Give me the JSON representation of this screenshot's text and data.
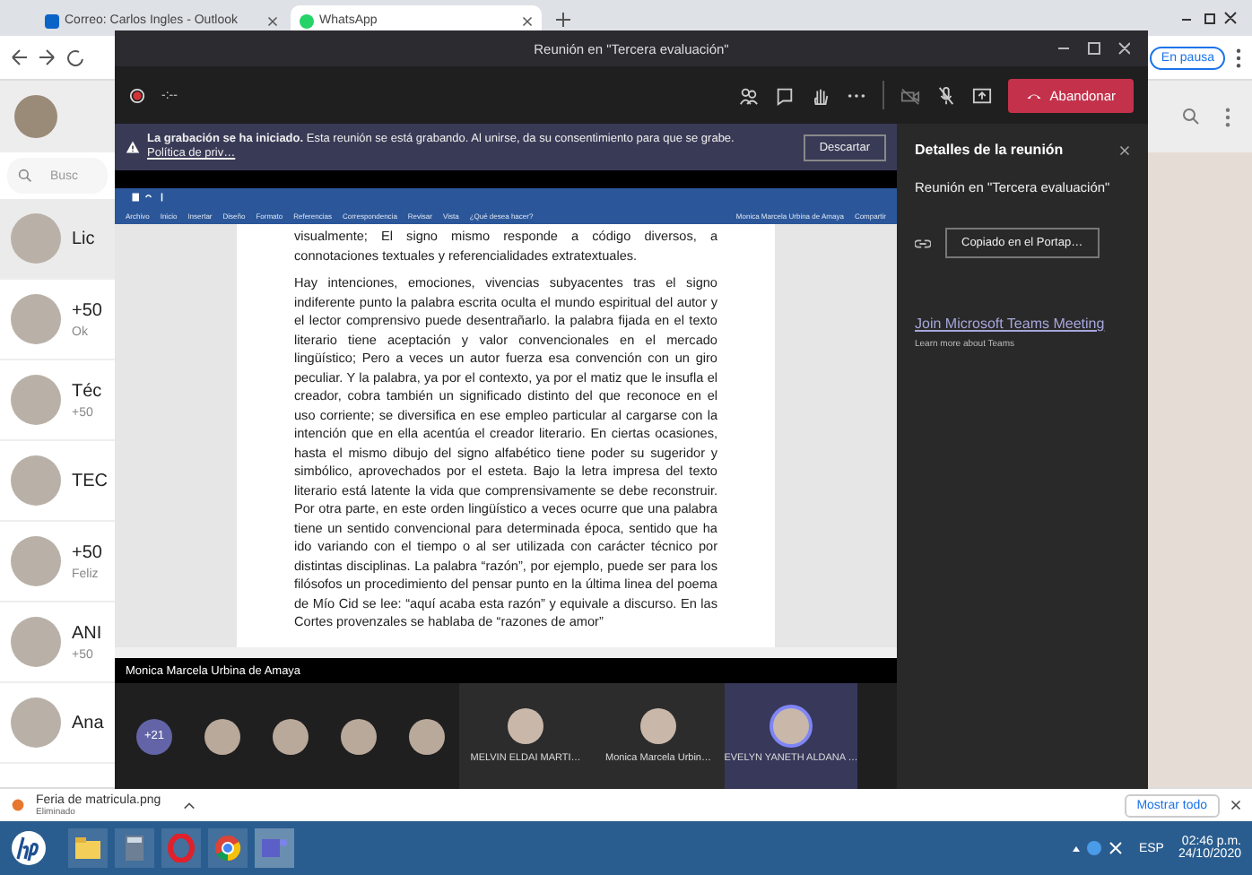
{
  "browser": {
    "tabs": [
      {
        "label": "Correo: Carlos Ingles - Outlook",
        "selected": false
      },
      {
        "label": "WhatsApp",
        "selected": true
      }
    ],
    "pause_badge": "En pausa"
  },
  "whatsapp": {
    "search_placeholder": "Busc",
    "chats": [
      {
        "name": "Lic",
        "selected": true
      },
      {
        "name": "+50",
        "preview": "Ok",
        "selected": false
      },
      {
        "name": "Téc",
        "preview": "+50",
        "selected": false
      },
      {
        "name": "TEC",
        "selected": false
      },
      {
        "name": "+50",
        "preview": "Feliz",
        "selected": false
      },
      {
        "name": "ANI",
        "preview": "+50",
        "selected": false
      },
      {
        "name": "Ana",
        "selected": false
      }
    ]
  },
  "teams": {
    "title": "Reunión en \"Tercera evaluación\"",
    "timer": "-:--",
    "leave_button": "Abandonar",
    "banner": {
      "text": "**La grabación se ha iniciado.** Esta reunión se está grabando. Al unirse, da su consentimiento para que se grabe.",
      "link": "Política de priv…",
      "button": "Descartar"
    },
    "shared_screen": {
      "ribbon_tabs": [
        "Archivo",
        "Inicio",
        "Insertar",
        "Diseño",
        "Formato",
        "Referencias",
        "Correspondencia",
        "Revisar",
        "Vista",
        "¿Qué desea hacer?"
      ],
      "user": "Monica Marcela Urbina de Amaya",
      "share": "Compartir",
      "paragraphs": [
        "visualmente; El signo mismo responde a código diversos, a connotaciones textuales y referencialidades extratextuales.",
        "Hay intenciones, emociones, vivencias subyacentes tras el signo indiferente punto la palabra escrita oculta el mundo espiritual del autor y el lector comprensivo puede desentrañarlo. la palabra fijada en el texto literario tiene aceptación y valor convencionales en el mercado lingüístico; Pero a veces un autor fuerza esa convención con un giro peculiar. Y la palabra, ya por el contexto, ya por el matiz que le insufla el creador, cobra también un significado distinto del que reconoce en el uso corriente; se diversifica en ese empleo particular al cargarse con la intención que en ella acentúa el creador literario. En ciertas ocasiones, hasta el mismo dibujo del signo alfabético tiene poder su sugeridor y simbólico, aprovechados por el esteta. Bajo la letra impresa del texto literario está latente la vida que comprensivamente se debe reconstruir. Por otra parte, en este orden lingüístico a veces ocurre que una palabra tiene un sentido convencional para determinada época, sentido que ha ido variando con el tiempo o al ser utilizada con carácter técnico por distintas disciplinas. La palabra “razón”, por ejemplo, puede ser para los filósofos un procedimiento del pensar punto en la última linea del poema de Mío Cid se lee: “aquí acaba esta razón” y equivale a discurso. En las Cortes provenzales se hablaba de “razones de amor”"
      ]
    },
    "presenter": "Monica Marcela Urbina de Amaya",
    "participants": {
      "overflow": "+21",
      "tiles": [
        {
          "name": "MELVIN ELDAI MARTI…",
          "speaking": false
        },
        {
          "name": "Monica Marcela Urbin…",
          "speaking": false
        },
        {
          "name": "EVELYN YANETH ALDANA …",
          "speaking": true
        }
      ]
    },
    "details": {
      "title": "Detalles de la reunión",
      "meeting": "Reunión en \"Tercera evaluación\"",
      "copy_button": "Copiado en el Portap…",
      "join_link": "Join Microsoft Teams Meeting",
      "learn_more": "Learn more about Teams"
    }
  },
  "downloads": {
    "file": "Feria de matricula.png",
    "status": "Eliminado",
    "show_all": "Mostrar todo"
  },
  "taskbar": {
    "language": "ESP",
    "time": "02:46 p.m.",
    "date": "24/10/2020"
  }
}
